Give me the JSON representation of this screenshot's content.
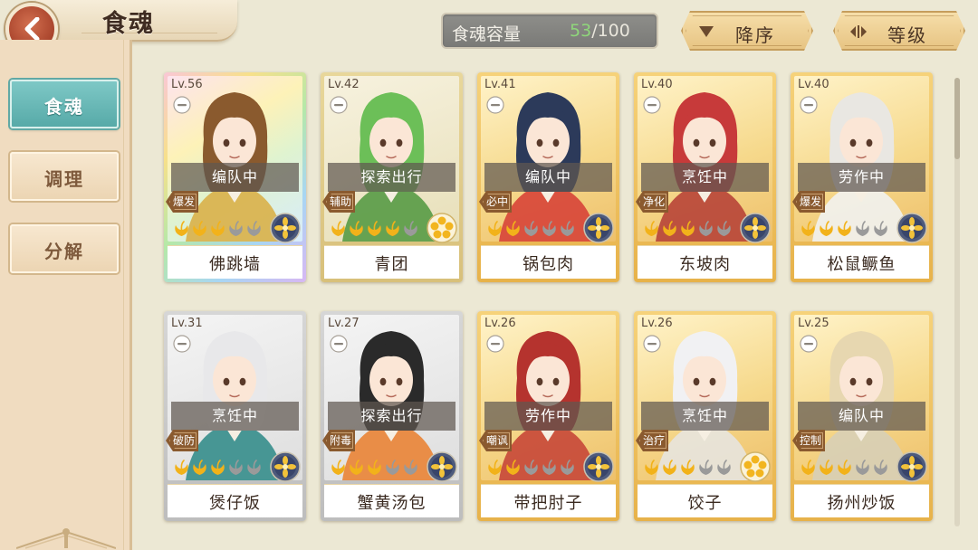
{
  "header": {
    "title": "食魂",
    "capacity_label": "食魂容量",
    "capacity_current": "53",
    "capacity_separator": "/",
    "capacity_total": "100",
    "sort_desc_label": "降序",
    "sort_level_label": "等级"
  },
  "sidebar": {
    "items": [
      {
        "label": "食魂",
        "active": true
      },
      {
        "label": "调理",
        "active": false
      },
      {
        "label": "分解",
        "active": false
      }
    ]
  },
  "colors": {
    "accent_teal": "#62a9a5",
    "back_button_red": "#a9442c",
    "capacity_green": "#8fd67b",
    "gold_frame": "#e7b24a"
  },
  "cards": [
    {
      "level": "Lv.56",
      "status": "编队中",
      "role": "爆发",
      "name": "佛跳墙",
      "frame": "rainbow",
      "emblem": "blue",
      "stars": 3,
      "hair": "#8a5a2e",
      "outfit": "#d9b24c"
    },
    {
      "level": "Lv.42",
      "status": "探索出行",
      "role": "辅助",
      "name": "青团",
      "frame": "green",
      "emblem": "gold",
      "stars": 4,
      "hair": "#6cbf58",
      "outfit": "#5a9c48"
    },
    {
      "level": "Lv.41",
      "status": "编队中",
      "role": "必中",
      "name": "锅包肉",
      "frame": "gold",
      "emblem": "blue",
      "stars": 2,
      "hair": "#2c3a5a",
      "outfit": "#d8463a"
    },
    {
      "level": "Lv.40",
      "status": "烹饪中",
      "role": "净化",
      "name": "东坡肉",
      "frame": "gold",
      "emblem": "blue",
      "stars": 3,
      "hair": "#c73a3a",
      "outfit": "#b8463a"
    },
    {
      "level": "Lv.40",
      "status": "劳作中",
      "role": "爆发",
      "name": "松鼠鳜鱼",
      "frame": "gold",
      "emblem": "blue",
      "stars": 3,
      "hair": "#e9e7e2",
      "outfit": "#f1f1ee"
    },
    {
      "level": "Lv.31",
      "status": "烹饪中",
      "role": "破防",
      "name": "煲仔饭",
      "frame": "silver",
      "emblem": "blue",
      "stars": 3,
      "hair": "#e8e8ea",
      "outfit": "#3a8f8d"
    },
    {
      "level": "Lv.27",
      "status": "探索出行",
      "role": "附毒",
      "name": "蟹黄汤包",
      "frame": "silver",
      "emblem": "blue",
      "stars": 3,
      "hair": "#2a2a2a",
      "outfit": "#e9853a"
    },
    {
      "level": "Lv.26",
      "status": "劳作中",
      "role": "嘲讽",
      "name": "带把肘子",
      "frame": "gold",
      "emblem": "blue",
      "stars": 2,
      "hair": "#b5332e",
      "outfit": "#c84a3a"
    },
    {
      "level": "Lv.26",
      "status": "烹饪中",
      "role": "治疗",
      "name": "饺子",
      "frame": "gold",
      "emblem": "gold",
      "stars": 3,
      "hair": "#f1f1f3",
      "outfit": "#e7e4dc"
    },
    {
      "level": "Lv.25",
      "status": "编队中",
      "role": "控制",
      "name": "扬州炒饭",
      "frame": "gold",
      "emblem": "blue",
      "stars": 3,
      "hair": "#e7d7b0",
      "outfit": "#d8cfb5"
    }
  ]
}
